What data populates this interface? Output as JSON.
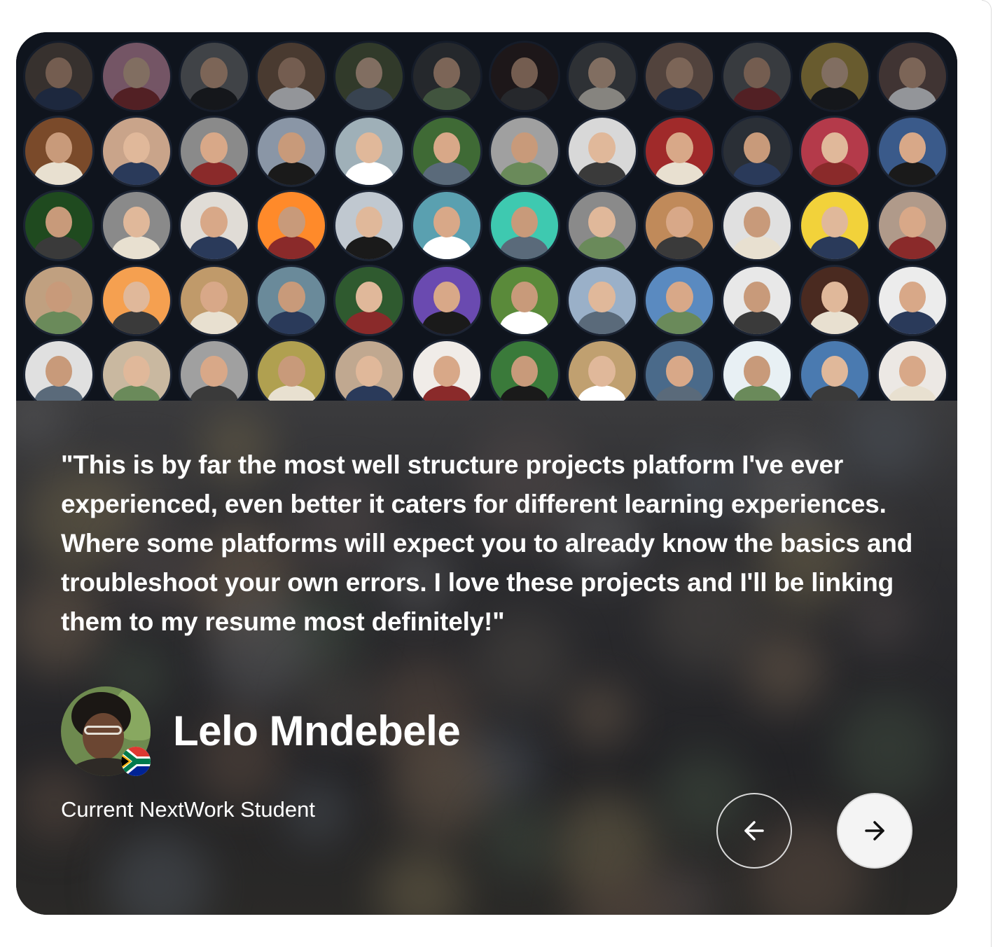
{
  "testimonial": {
    "quote": "\"This is by far the most well structure projects platform I've ever experienced, even better it caters for different learning experiences. Where some platforms will expect you to already know the basics and troubleshoot your own errors. I love these projects and I'll be linking them to my resume most definitely!\"",
    "author_name": "Lelo Mndebele",
    "author_role": "Current NextWork Student",
    "author_country_flag": "south-africa-flag-icon"
  },
  "navigation": {
    "prev_icon": "arrow-left-icon",
    "next_icon": "arrow-right-icon"
  },
  "colors": {
    "text": "#ffffff",
    "card_dark": "#16161a",
    "grid_bg": "#0f141d",
    "button_light": "#f4f4f4",
    "button_border": "#d9d9d9"
  }
}
